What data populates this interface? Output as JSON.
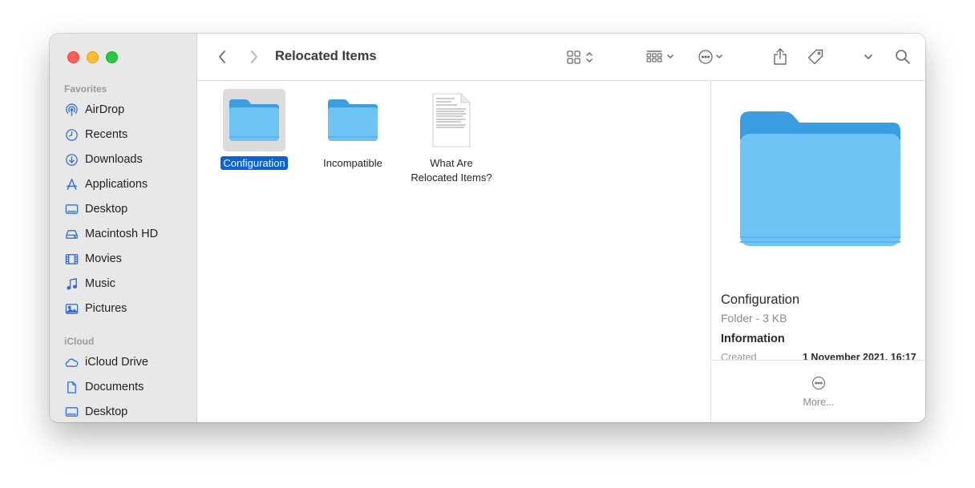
{
  "window": {
    "title": "Relocated Items"
  },
  "sidebar": {
    "favorites_header": "Favorites",
    "favorites": [
      {
        "label": "AirDrop",
        "icon": "airdrop-icon"
      },
      {
        "label": "Recents",
        "icon": "clock-icon"
      },
      {
        "label": "Downloads",
        "icon": "download-icon"
      },
      {
        "label": "Applications",
        "icon": "applications-icon"
      },
      {
        "label": "Desktop",
        "icon": "desktop-icon"
      },
      {
        "label": "Macintosh HD",
        "icon": "hard-drive-icon"
      },
      {
        "label": "Movies",
        "icon": "film-icon"
      },
      {
        "label": "Music",
        "icon": "music-note-icon"
      },
      {
        "label": "Pictures",
        "icon": "photo-icon"
      }
    ],
    "icloud_header": "iCloud",
    "icloud": [
      {
        "label": "iCloud Drive",
        "icon": "cloud-icon"
      },
      {
        "label": "Documents",
        "icon": "document-icon"
      },
      {
        "label": "Desktop",
        "icon": "desktop-icon"
      }
    ]
  },
  "files": [
    {
      "name": "Configuration",
      "kind": "folder",
      "selected": true
    },
    {
      "name": "Incompatible",
      "kind": "folder",
      "selected": false
    },
    {
      "name_line1": "What Are",
      "name_line2": "Relocated Items?",
      "kind": "document",
      "selected": false
    }
  ],
  "preview": {
    "name": "Configuration",
    "meta": "Folder - 3 KB",
    "info_header": "Information",
    "created_label": "Created",
    "created_value": "1 November 2021, 16:17",
    "more_label": "More..."
  },
  "colors": {
    "accent": "#0a63d6",
    "folder": "#6cc3f4",
    "sidebar_icon": "#2f6fd6",
    "traffic_red": "#ff5f57",
    "traffic_yellow": "#febc2e",
    "traffic_green": "#28c840"
  }
}
